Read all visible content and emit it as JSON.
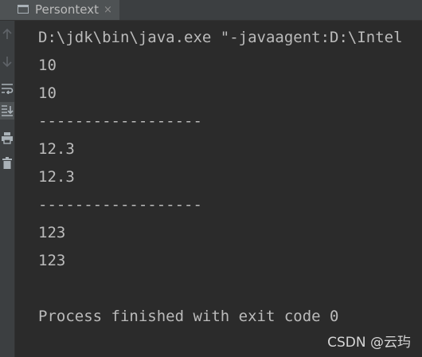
{
  "tab": {
    "title": "Persontext",
    "close_glyph": "×"
  },
  "console": {
    "lines": [
      "D:\\jdk\\bin\\java.exe \"-javaagent:D:\\Intel",
      "10",
      "10",
      "------------------",
      "12.3",
      "12.3",
      "------------------",
      "123",
      "123",
      "",
      "Process finished with exit code 0"
    ],
    "text_color": "#bbbbbb",
    "background": "#2b2b2b"
  },
  "gutter": {
    "icons": [
      "rerun-up-icon",
      "down-arrow-icon",
      "soft-wrap-icon",
      "scroll-to-end-icon",
      "print-icon",
      "trash-icon"
    ]
  },
  "watermark": {
    "text": "CSDN @云玙"
  }
}
